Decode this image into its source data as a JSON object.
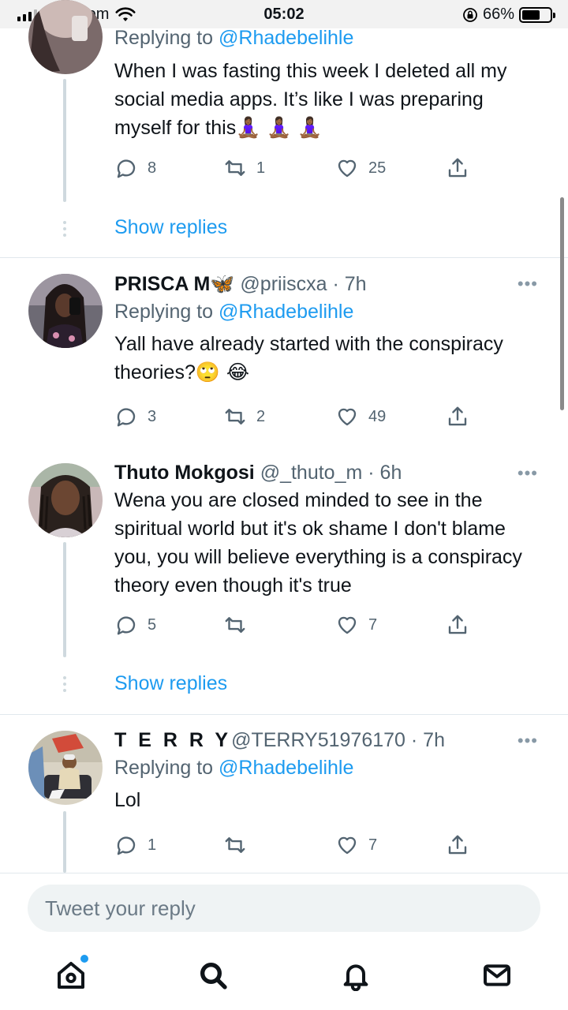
{
  "status_bar": {
    "carrier": "Vodacom",
    "time": "05:02",
    "battery": "66%",
    "battery_level": 0.66
  },
  "mention": "@Rhadebelihle",
  "replying_prefix": "Replying to ",
  "tweets": [
    {
      "text": "When I was fasting this week I deleted all my social media apps. It’s like I was preparing myself for this",
      "emojis": "🧘🏾‍♀️ 🧘🏾‍♀️ 🧘🏾‍♀️",
      "replies": "8",
      "retweets": "1",
      "likes": "25",
      "show_replies": "Show replies"
    },
    {
      "name": "PRISCA M",
      "name_emoji": "🦋",
      "handle": "@priiscxa",
      "time": "· 7h",
      "text": "Yall have already started with the conspiracy theories?",
      "emojis": "🙄 😂",
      "replies": "3",
      "retweets": "2",
      "likes": "49"
    },
    {
      "name": "Thuto Mokgosi",
      "handle": "@_thuto_m",
      "time": "· 6h",
      "text": "Wena you are closed minded to see in the spiritual world but it's ok shame I don't blame you, you will believe everything is a conspiracy theory even though it's true",
      "replies": "5",
      "retweets": "",
      "likes": "7",
      "show_replies": "Show replies"
    },
    {
      "name": "T E R R Y",
      "handle": "@TERRY51976170",
      "time": "· 7h",
      "text": "Lol",
      "replies": "1",
      "retweets": "",
      "likes": "7"
    }
  ],
  "more_label": "•••",
  "reply_placeholder": "Tweet your reply",
  "nav": [
    "home-icon",
    "search-icon",
    "notifications-icon",
    "messages-icon"
  ],
  "colors": {
    "accent": "#1d9bf0",
    "muted": "#536471",
    "thread": "#cfd9de"
  }
}
